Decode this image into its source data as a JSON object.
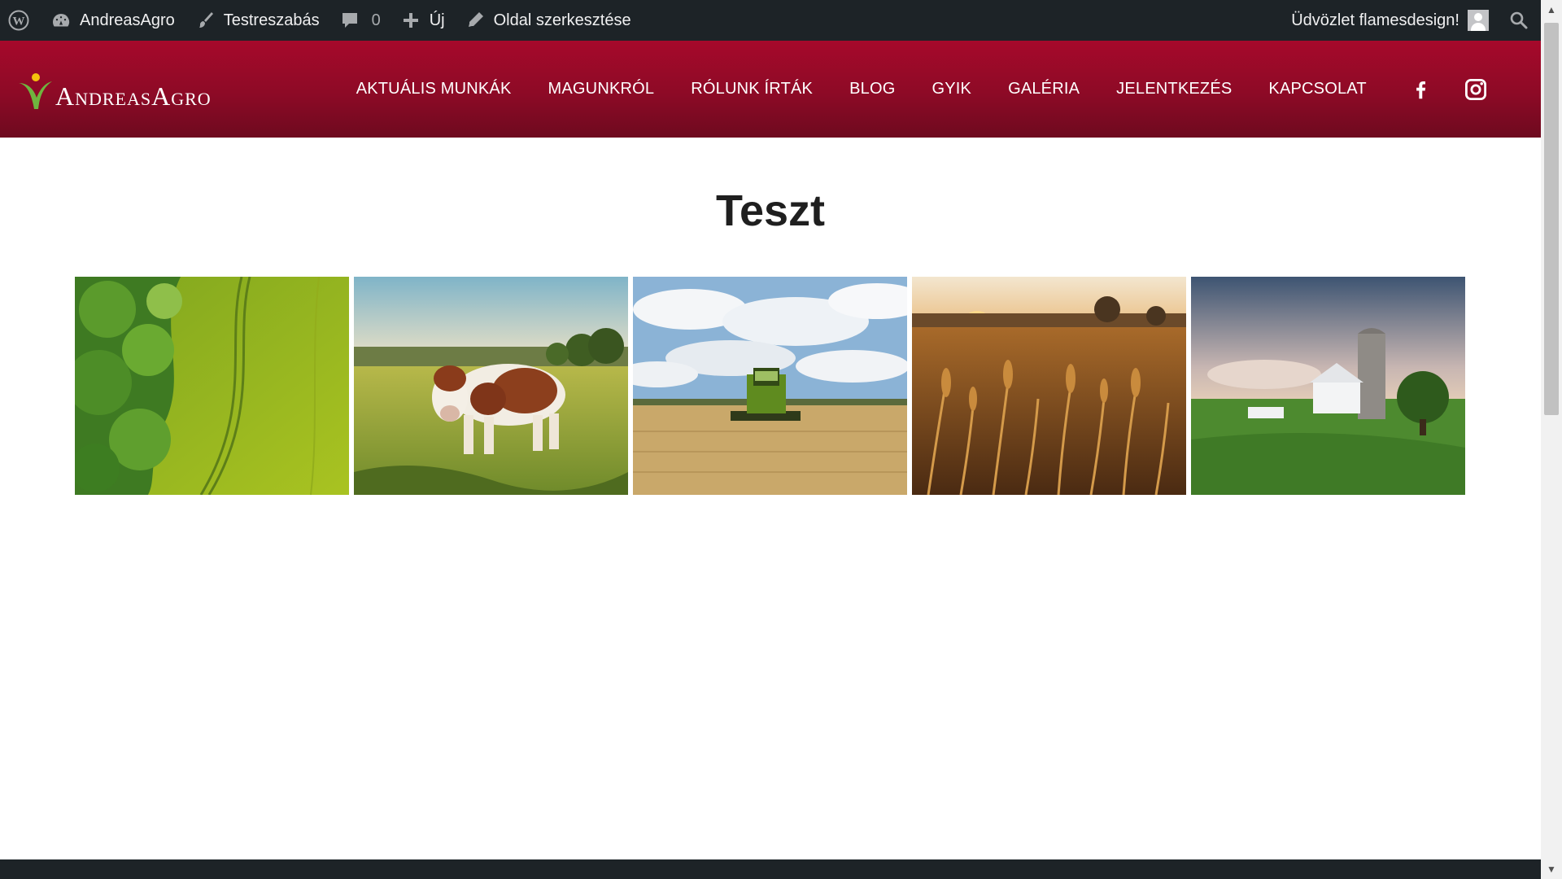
{
  "adminbar": {
    "site_name": "AndreasAgro",
    "customize": "Testreszabás",
    "comments_count": "0",
    "new_label": "Új",
    "edit_page": "Oldal szerkesztése",
    "greeting": "Üdvözlet flamesdesign!"
  },
  "header": {
    "logo_text": "AndreasAgro",
    "nav": [
      "AKTUÁLIS MUNKÁK",
      "MAGUNKRÓL",
      "RÓLUNK ÍRTÁK",
      "BLOG",
      "GYIK",
      "GALÉRIA",
      "JELENTKEZÉS",
      "KAPCSOLAT"
    ],
    "social": [
      "facebook-icon",
      "instagram-icon"
    ]
  },
  "main": {
    "title": "Teszt",
    "gallery": [
      "aerial-field",
      "cow-in-pasture",
      "combine-harvester",
      "wheat-sunset",
      "barn-and-silo"
    ]
  },
  "colors": {
    "adminbar_bg": "#1d2327",
    "header_red": "#a6092b",
    "title_text": "#1f1f1f"
  }
}
